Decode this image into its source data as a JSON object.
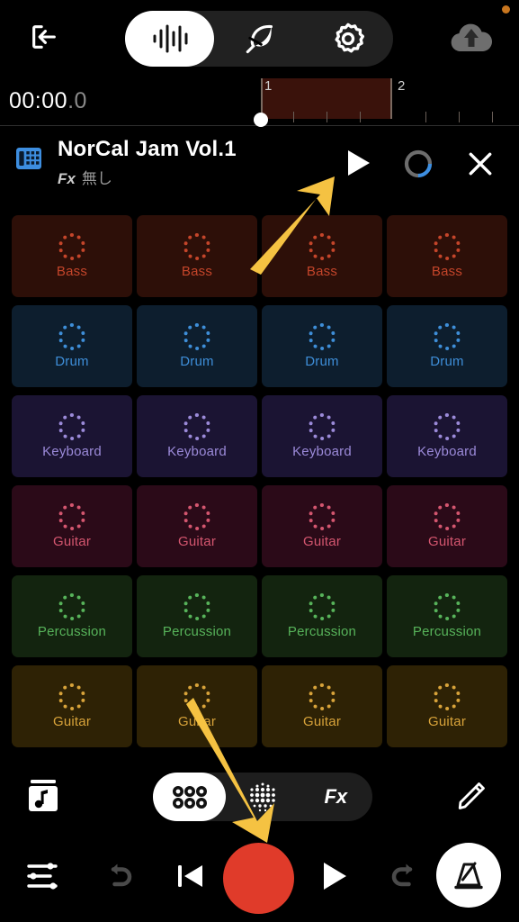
{
  "topbar": {
    "exit_icon": "exit-icon",
    "segments": [
      {
        "icon": "waveform-icon",
        "name": "audio-mode",
        "active": true
      },
      {
        "icon": "feather-icon",
        "name": "midi-mode",
        "active": false
      },
      {
        "icon": "gear-icon",
        "name": "settings-mode",
        "active": false
      }
    ],
    "cloud_icon": "cloud-upload-icon",
    "notification_dot_color": "#c8761f"
  },
  "timeline": {
    "timecode_main": "00:00",
    "timecode_frac": ".0",
    "bars": [
      "1",
      "2"
    ],
    "loop_region_color": "#3a120b"
  },
  "project": {
    "grid_icon": "matrix-grid-icon",
    "title": "NorCal Jam Vol.1",
    "fx_tag": "Fx",
    "fx_value": "無し",
    "play_icon": "play-icon",
    "loop_icon": "loop-progress-icon",
    "close_icon": "close-icon",
    "accent_blue": "#3d8ee0"
  },
  "grid": {
    "rows": [
      {
        "label": "Bass",
        "bg": "#2d0f08",
        "fg": "#c4452a",
        "cells": [
          "Bass",
          "Bass",
          "Bass",
          "Bass"
        ]
      },
      {
        "label": "Drum",
        "bg": "#0d1e2e",
        "fg": "#3e8ed8",
        "cells": [
          "Drum",
          "Drum",
          "Drum",
          "Drum"
        ]
      },
      {
        "label": "Keyboard",
        "bg": "#1b1433",
        "fg": "#9b8ad9",
        "cells": [
          "Keyboard",
          "Keyboard",
          "Keyboard",
          "Keyboard"
        ]
      },
      {
        "label": "Guitar",
        "bg": "#2b0a18",
        "fg": "#d4566f",
        "cells": [
          "Guitar",
          "Guitar",
          "Guitar",
          "Guitar"
        ]
      },
      {
        "label": "Percussion",
        "bg": "#13240f",
        "fg": "#57b35a",
        "cells": [
          "Percussion",
          "Percussion",
          "Percussion",
          "Percussion"
        ]
      },
      {
        "label": "Guitar",
        "bg": "#2e2205",
        "fg": "#d8a33a",
        "cells": [
          "Guitar",
          "Guitar",
          "Guitar",
          "Guitar"
        ]
      }
    ]
  },
  "modebar": {
    "library_icon": "music-library-icon",
    "modes": [
      {
        "icon": "six-dot-grid-icon",
        "name": "clips-mode",
        "active": true
      },
      {
        "icon": "dot-matrix-icon",
        "name": "pads-mode",
        "active": false
      },
      {
        "icon": "fx-label",
        "label": "Fx",
        "name": "fx-mode",
        "active": false
      }
    ],
    "pencil_icon": "pencil-icon"
  },
  "transport": {
    "mixer_icon": "mixer-sliders-icon",
    "undo_icon": "undo-icon",
    "skip_back_icon": "skip-back-icon",
    "record_icon": "record-button",
    "record_color": "#e03b2a",
    "play_icon": "play-icon",
    "redo_icon": "redo-icon",
    "metronome_icon": "metronome-icon"
  },
  "annotations": {
    "arrow_color": "#f5c242",
    "arrows": [
      {
        "name": "arrow-to-header-play",
        "points_to": "project-play-button"
      },
      {
        "name": "arrow-to-record",
        "points_to": "record-button"
      }
    ]
  }
}
